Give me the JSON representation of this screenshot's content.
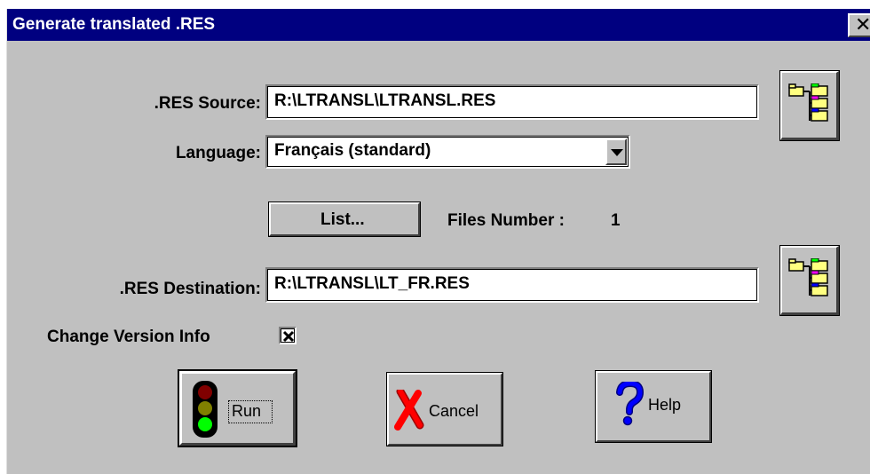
{
  "window": {
    "title": "Generate translated .RES",
    "close_glyph": "✕"
  },
  "form": {
    "source_label": ".RES Source:",
    "source_value": "R:\\LTRANSL\\LTRANSL.RES",
    "language_label": "Language:",
    "language_value": "Français (standard)",
    "list_button": "List...",
    "files_number_label": "Files Number :",
    "files_number_value": "1",
    "destination_label": ".RES Destination:",
    "destination_value": "R:\\LTRANSL\\LT_FR.RES",
    "change_version_label": "Change Version Info",
    "change_version_checked": true
  },
  "buttons": {
    "run": "Run",
    "cancel": "Cancel",
    "help": "Help"
  },
  "icons": {
    "browse_source": "folder-tree-icon",
    "browse_destination": "folder-tree-icon",
    "run": "traffic-light-icon",
    "cancel": "red-x-icon",
    "help": "question-mark-icon",
    "dropdown": "chevron-down-icon"
  },
  "colors": {
    "titlebar": "#000080",
    "dialog_bg": "#c0c0c0",
    "traffic_red": "#800000",
    "traffic_yellow": "#808000",
    "traffic_green": "#00ff00",
    "cancel_red": "#ff0000",
    "help_blue": "#0000ff"
  }
}
